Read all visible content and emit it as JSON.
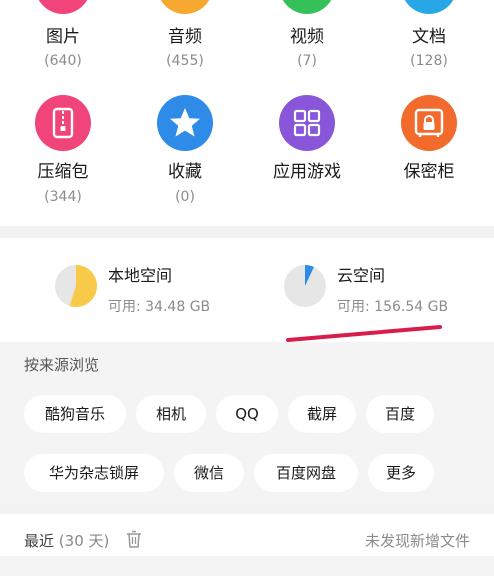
{
  "categories": [
    {
      "name": "图片",
      "count": "(640)",
      "color": "#f0447a",
      "icon": "image-icon"
    },
    {
      "name": "音频",
      "count": "(455)",
      "color": "#f7a830",
      "icon": "audio-icon"
    },
    {
      "name": "视频",
      "count": "(7)",
      "color": "#35c05a",
      "icon": "video-icon"
    },
    {
      "name": "文档",
      "count": "(128)",
      "color": "#27a7e6",
      "icon": "document-icon"
    },
    {
      "name": "压缩包",
      "count": "(344)",
      "color": "#f0447a",
      "icon": "zip-icon"
    },
    {
      "name": "收藏",
      "count": "(0)",
      "color": "#2f8be8",
      "icon": "star-icon"
    },
    {
      "name": "应用游戏",
      "count": "",
      "color": "#8a56d9",
      "icon": "apps-icon"
    },
    {
      "name": "保密柜",
      "count": "",
      "color": "#f26a2c",
      "icon": "safe-icon"
    }
  ],
  "storage": {
    "local": {
      "title": "本地空间",
      "available": "可用: 34.48 GB",
      "used_fraction": 0.55,
      "color": "#f9c94a"
    },
    "cloud": {
      "title": "云空间",
      "available": "可用: 156.54 GB",
      "used_fraction": 0.07,
      "color": "#2f8be8"
    }
  },
  "source_browse": {
    "label": "按来源浏览",
    "chips": [
      "酷狗音乐",
      "相机",
      "QQ",
      "截屏",
      "百度",
      "华为杂志锁屏",
      "微信",
      "百度网盘",
      "更多"
    ]
  },
  "recent": {
    "label": "最近",
    "days": "(30 天)",
    "status": "未发现新增文件"
  },
  "colors": {
    "annotation_red": "#d81d4b",
    "pie_base": "#e6e6e6"
  }
}
